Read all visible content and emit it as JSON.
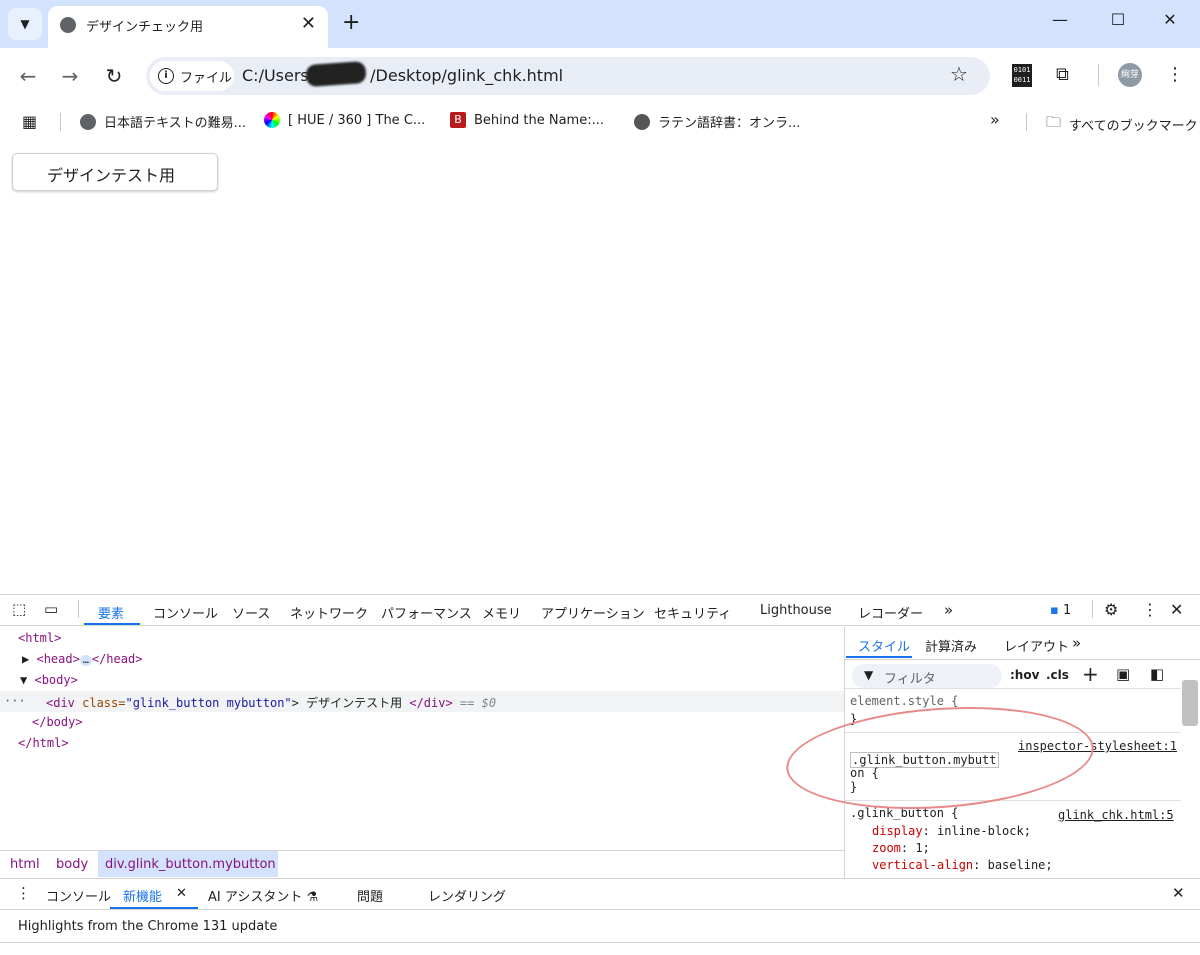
{
  "tab": {
    "title": "デザインチェック用",
    "close": "✕"
  },
  "window": {
    "minimize": "—",
    "maximize": "☐",
    "close": "✕",
    "new_tab": "+"
  },
  "nav": {
    "back": "←",
    "forward": "→",
    "reload": "↻"
  },
  "omnibox": {
    "chip_label": "ファイル",
    "url_prefix": "C:/Users/",
    "url_suffix": "/Desktop/glink_chk.html",
    "star": "☆"
  },
  "toolbar": {
    "binary_icon_text": "0101\n0011",
    "avatar": "絢芽",
    "menu": "⋮",
    "extension": "⧉"
  },
  "bookmarks": {
    "items": [
      {
        "label": "日本語テキストの難易...",
        "icon": "globe-icon",
        "color": "#5f6368"
      },
      {
        "label": "[ HUE / 360 ] The C...",
        "icon": "color-wheel-icon",
        "color": "#e040fb"
      },
      {
        "label": "Behind the Name:...",
        "icon": "b-logo-icon",
        "color": "#b71c1c"
      },
      {
        "label": "ラテン語辞書：オンラ...",
        "icon": "person-icon",
        "color": "#555555"
      }
    ],
    "more": "»",
    "all_bookmarks": "すべてのブックマーク"
  },
  "page": {
    "button_label": "デザインテスト用"
  },
  "devtools": {
    "tabs": [
      "要素",
      "コンソール",
      "ソース",
      "ネットワーク",
      "パフォーマンス",
      "メモリ",
      "アプリケーション",
      "セキュリティ",
      "Lighthouse",
      "レコーダー"
    ],
    "more": "»",
    "issues_count": "1",
    "elements": {
      "html_open": "<html>",
      "head": "<head>",
      "head_close": "</head>",
      "body_open": "<body>",
      "div_tag": "<div ",
      "div_attr": "class=",
      "div_val": "\"glink_button mybutton\"",
      "div_text": "> デザインテスト用 ",
      "div_close": "</div>",
      "div_eq": " == $0",
      "body_close": "</body>",
      "html_close": "</html>",
      "ellipsis": "…",
      "row_dots": "···"
    },
    "breadcrumb": [
      "html",
      "body",
      "div.glink_button.mybutton"
    ],
    "styles": {
      "tabs": [
        "スタイル",
        "計算済み",
        "レイアウト"
      ],
      "more": "»",
      "filter": "フィルタ",
      "hov": ":hov",
      "cls": ".cls",
      "element_style": "element.style {",
      "brace_close": "}",
      "inspector_source": "inspector-stylesheet:1",
      "selector_line1": ".glink_button.mybutt",
      "selector_line2": "on {",
      "glink_selector": ".glink_button {",
      "glink_source": "glink_chk.html:5",
      "props": [
        {
          "name": "display",
          "value": "inline-block;"
        },
        {
          "name": "zoom",
          "value": "1;"
        },
        {
          "name": "vertical-align",
          "value": "baseline;"
        }
      ]
    }
  },
  "drawer": {
    "tabs": [
      "コンソール",
      "新機能",
      "AI アシスタント",
      "問題",
      "レンダリング"
    ],
    "active_close": "✕",
    "headline": "Highlights from the Chrome 131 update",
    "close": "✕"
  }
}
